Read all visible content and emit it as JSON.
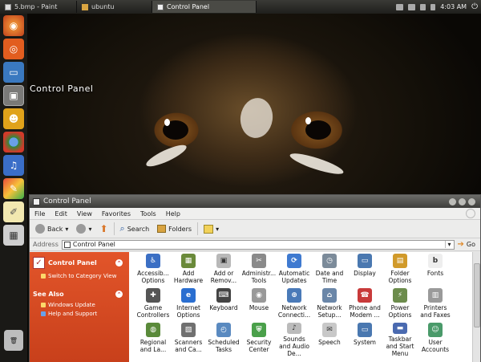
{
  "taskbar": {
    "tasks": [
      "5.bmp - Paint",
      "ubuntu",
      "Control Panel"
    ],
    "time": "4:03 AM"
  },
  "desktop": {
    "label": "Control Panel"
  },
  "window": {
    "title": "Control Panel",
    "menu": [
      "File",
      "Edit",
      "View",
      "Favorites",
      "Tools",
      "Help"
    ],
    "toolbar": {
      "back": "Back",
      "search": "Search",
      "folders": "Folders"
    },
    "address": {
      "label": "Address",
      "value": "Control Panel",
      "go": "Go"
    },
    "left_pane": {
      "title": "Control Panel",
      "switch_link": "Switch to Category View",
      "see_also_title": "See Also",
      "links": [
        "Windows Update",
        "Help and Support"
      ]
    },
    "items": [
      {
        "label": "Accessib... Options",
        "color": "#3b6fc4",
        "glyph": "♿"
      },
      {
        "label": "Add Hardware",
        "color": "#6a8a3a",
        "glyph": "▦"
      },
      {
        "label": "Add or Remov...",
        "color": "#b8b8b8",
        "glyph": "▣"
      },
      {
        "label": "Administr... Tools",
        "color": "#8a8a8a",
        "glyph": "✂"
      },
      {
        "label": "Automatic Updates",
        "color": "#3f7ad0",
        "glyph": "⟳"
      },
      {
        "label": "Date and Time",
        "color": "#7c8b9a",
        "glyph": "◷"
      },
      {
        "label": "Display",
        "color": "#4a78b0",
        "glyph": "▭"
      },
      {
        "label": "Folder Options",
        "color": "#d19a2a",
        "glyph": "▤"
      },
      {
        "label": "Fonts",
        "color": "#eeeeee",
        "glyph": "b"
      },
      {
        "label": "Game Controllers",
        "color": "#555555",
        "glyph": "✚"
      },
      {
        "label": "Internet Options",
        "color": "#2a6ed0",
        "glyph": "e"
      },
      {
        "label": "Keyboard",
        "color": "#444444",
        "glyph": "⌨"
      },
      {
        "label": "Mouse",
        "color": "#999999",
        "glyph": "◉"
      },
      {
        "label": "Network Connecti...",
        "color": "#4a7ab8",
        "glyph": "⊕"
      },
      {
        "label": "Network Setup...",
        "color": "#6a86a8",
        "glyph": "⌂"
      },
      {
        "label": "Phone and Modem ...",
        "color": "#c83a3a",
        "glyph": "☎"
      },
      {
        "label": "Power Options",
        "color": "#6c8c4c",
        "glyph": "⚡"
      },
      {
        "label": "Printers and Faxes",
        "color": "#9a9a9a",
        "glyph": "▥"
      },
      {
        "label": "Regional and La...",
        "color": "#5a8a3a",
        "glyph": "◍"
      },
      {
        "label": "Scanners and Ca...",
        "color": "#707070",
        "glyph": "▧"
      },
      {
        "label": "Scheduled Tasks",
        "color": "#5a8ac0",
        "glyph": "◴"
      },
      {
        "label": "Security Center",
        "color": "#4aa04a",
        "glyph": "⛨"
      },
      {
        "label": "Sounds and Audio De...",
        "color": "#bbbbbb",
        "glyph": "♪"
      },
      {
        "label": "Speech",
        "color": "#c8c8c8",
        "glyph": "✉"
      },
      {
        "label": "System",
        "color": "#4a78b0",
        "glyph": "▭"
      },
      {
        "label": "Taskbar and Start Menu",
        "color": "#4a6ab0",
        "glyph": "▬"
      },
      {
        "label": "User Accounts",
        "color": "#4a9a6a",
        "glyph": "☺"
      }
    ]
  }
}
